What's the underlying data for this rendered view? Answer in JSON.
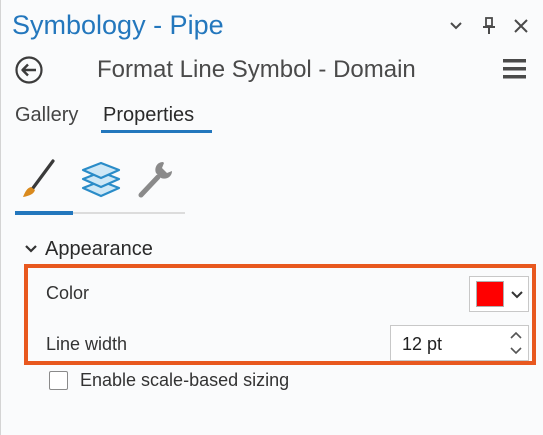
{
  "window": {
    "title": "Symbology - Pipe",
    "subtitle": "Format Line Symbol - Domain"
  },
  "titlebar_icons": [
    "chevron-down-icon",
    "pin-icon",
    "close-icon"
  ],
  "tabs": [
    {
      "label": "Gallery",
      "active": false
    },
    {
      "label": "Properties",
      "active": true
    }
  ],
  "subtabs": [
    {
      "icon": "paintbrush-icon",
      "active": true
    },
    {
      "icon": "layers-icon",
      "active": false
    },
    {
      "icon": "wrench-icon",
      "active": false
    }
  ],
  "appearance": {
    "section_title": "Appearance",
    "expanded": true,
    "color_label": "Color",
    "color_value": "#ff0000",
    "line_width_label": "Line width",
    "line_width_value": "12 pt"
  },
  "scale_based_sizing": {
    "label": "Enable scale-based sizing",
    "checked": false
  },
  "colors": {
    "accent": "#2377bd",
    "highlight_border": "#e8581f"
  }
}
